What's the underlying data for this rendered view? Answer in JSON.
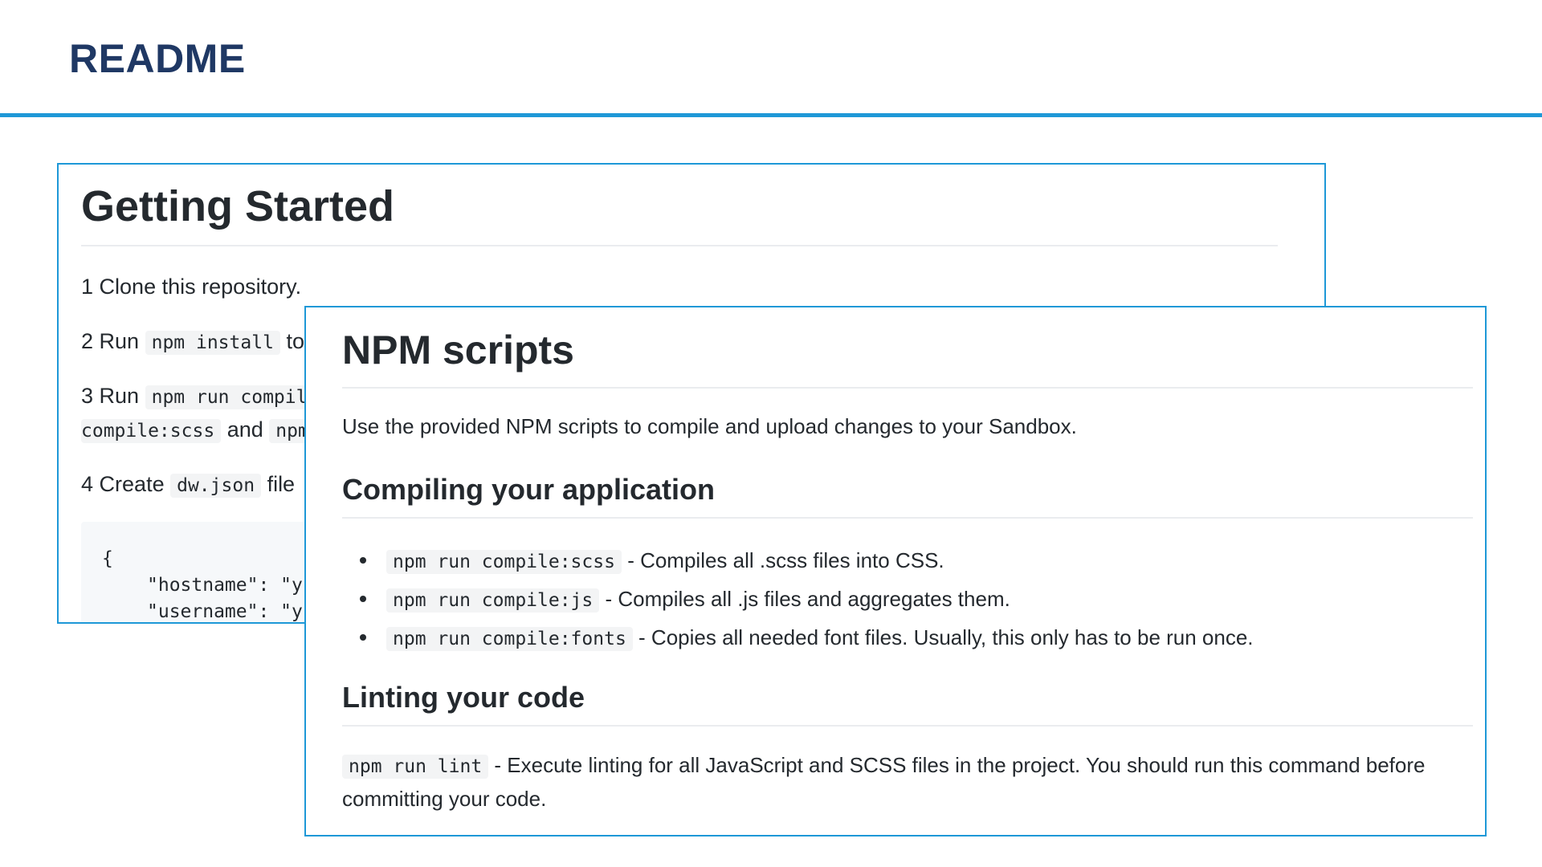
{
  "slide": {
    "title": "README"
  },
  "getting_started": {
    "heading": "Getting Started",
    "steps": [
      {
        "number": "1",
        "text": "Clone this repository."
      },
      {
        "number": "2",
        "prefix": "Run",
        "code": "npm install",
        "suffix": "to"
      },
      {
        "number": "3",
        "prefix": "Run",
        "code": "npm run compil",
        "line2_code_a": "compile:scss",
        "line2_and": "and",
        "line2_code_b": "npm"
      },
      {
        "number": "4",
        "prefix": "Create",
        "code": "dw.json",
        "suffix": "file"
      }
    ],
    "code_block": {
      "open_brace": "{",
      "line1": "\"hostname\": \"y",
      "line2": "\"username\": \"y"
    }
  },
  "npm_scripts": {
    "heading": "NPM scripts",
    "intro": "Use the provided NPM scripts to compile and upload changes to your Sandbox.",
    "compiling": {
      "heading": "Compiling your application",
      "items": [
        {
          "code": "npm run compile:scss",
          "text": "- Compiles all .scss files into CSS."
        },
        {
          "code": "npm run compile:js",
          "text": "- Compiles all .js files and aggregates them."
        },
        {
          "code": "npm run compile:fonts",
          "text": "- Copies all needed font files. Usually, this only has to be run once."
        }
      ]
    },
    "linting": {
      "heading": "Linting your code",
      "code": "npm run lint",
      "text": "- Execute linting for all JavaScript and SCSS files in the project. You should run this command before committing your code."
    }
  },
  "colors": {
    "title": "#1f3864",
    "accent_rule": "#1e98d7",
    "card_border": "#1e98d7"
  }
}
